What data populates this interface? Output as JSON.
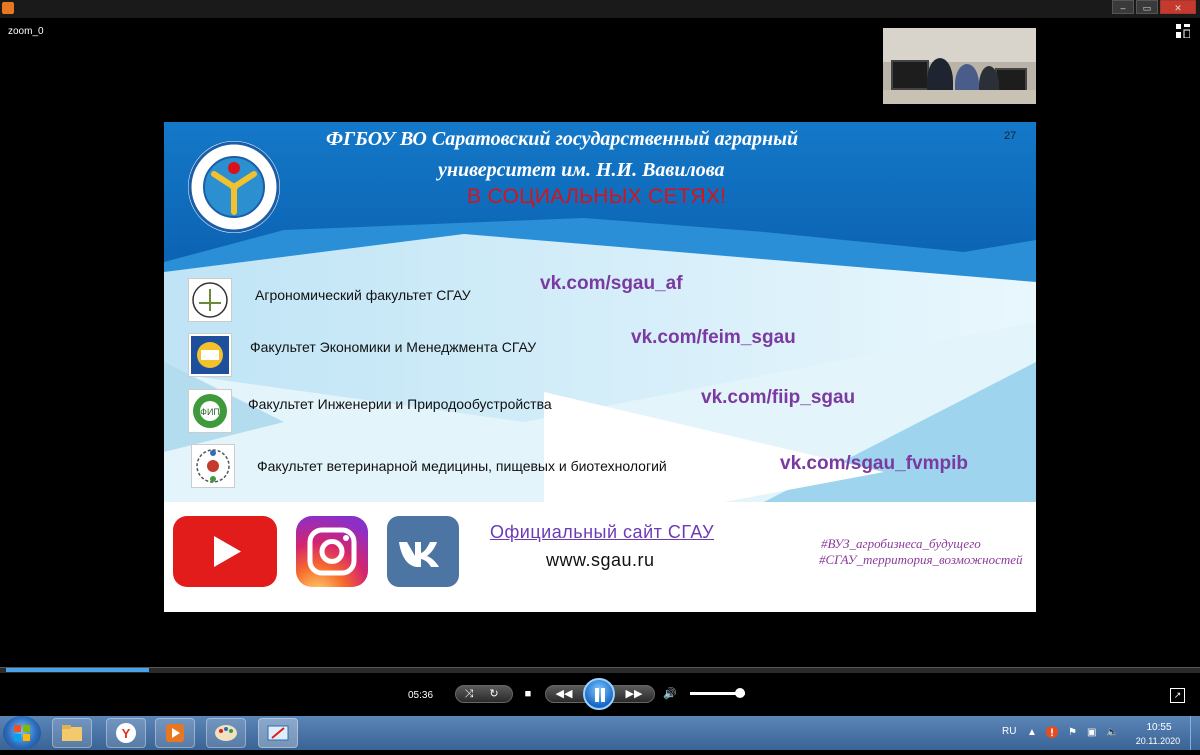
{
  "window": {
    "title": "",
    "zoom_label": "zoom_0",
    "min_label": "–",
    "max_label": "▭",
    "close_label": "✕"
  },
  "slide": {
    "title_line1": "ФГБОУ ВО Саратовский государственный аграрный",
    "title_line2": "университет им. Н.И. Вавилова",
    "subtitle": "В СОЦИАЛЬНЫХ СЕТЯХ!",
    "page_number": "27",
    "faculties": [
      {
        "name": "Агрономический факультет СГАУ",
        "link": "vk.com/sgau_af"
      },
      {
        "name": "Факультет Экономики и Менеджмента СГАУ",
        "link": "vk.com/feim_sgau"
      },
      {
        "name": "Факультет Инженерии и Природообустройства",
        "link": "vk.com/fiip_sgau"
      },
      {
        "name": "Факультет ветеринарной медицины, пищевых и биотехнологий",
        "link": "vk.com/sgau_fvmpib"
      }
    ],
    "official_site_label": "Официальный сайт СГАУ",
    "site_url": "www.sgau.ru",
    "hashtags": [
      "#ВУЗ_агробизнеса_будущего",
      "#СГАУ_территория_возможностей"
    ],
    "social": {
      "youtube": "youtube-icon",
      "instagram": "instagram-icon",
      "vk": "vk-icon"
    },
    "colors": {
      "header_blue": "#0d6fc2",
      "subtitle_red": "#d8121a",
      "link_purple": "#7a3aa0"
    }
  },
  "player": {
    "elapsed": "05:36",
    "progress": 0.12,
    "volume": 0.9
  },
  "taskbar": {
    "language": "RU",
    "time": "10:55",
    "date": "20.11.2020"
  }
}
